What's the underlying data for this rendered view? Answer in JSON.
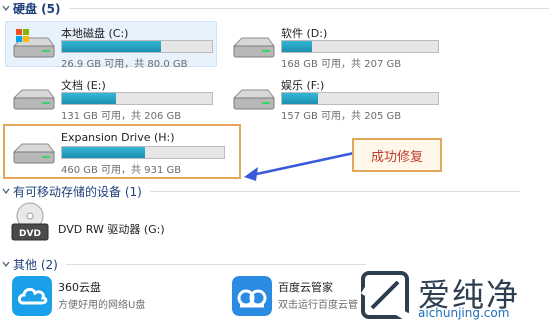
{
  "sections": {
    "hard_disks": "硬盘 (5)",
    "removable": "有可移动存储的设备 (1)",
    "other": "其他 (2)"
  },
  "drives": [
    {
      "name": "本地磁盘 (C:)",
      "info": "26.9 GB 可用，共 80.0 GB",
      "used_fraction": 0.66
    },
    {
      "name": "软件 (D:)",
      "info": "168 GB 可用，共 207 GB",
      "used_fraction": 0.19
    },
    {
      "name": "文档 (E:)",
      "info": "131 GB 可用，共 206 GB",
      "used_fraction": 0.36
    },
    {
      "name": "娱乐 (F:)",
      "info": "157 GB 可用，共 205 GB",
      "used_fraction": 0.23
    },
    {
      "name": "Expansion Drive (H:)",
      "info": "460 GB 可用，共 931 GB",
      "used_fraction": 0.51
    }
  ],
  "callout": "成功修复",
  "dvd": {
    "name": "DVD RW 驱动器 (G:)",
    "icon_label": "DVD"
  },
  "apps": [
    {
      "name": "360云盘",
      "desc": "方便好用的网络U盘",
      "icon": "cloud-icon",
      "color": "#1aa0e8"
    },
    {
      "name": "百度云管家",
      "desc": "双击运行百度云管",
      "icon": "baidu-cloud-icon",
      "color": "#2a8be0"
    }
  ],
  "watermark": {
    "brand": "爱纯净",
    "url": "aichunjing.com"
  },
  "colors": {
    "highlight": "#e3a65b",
    "callout_text": "#c0392b",
    "bar_fill": "#26a3c6",
    "section_title": "#1e3f7a"
  }
}
